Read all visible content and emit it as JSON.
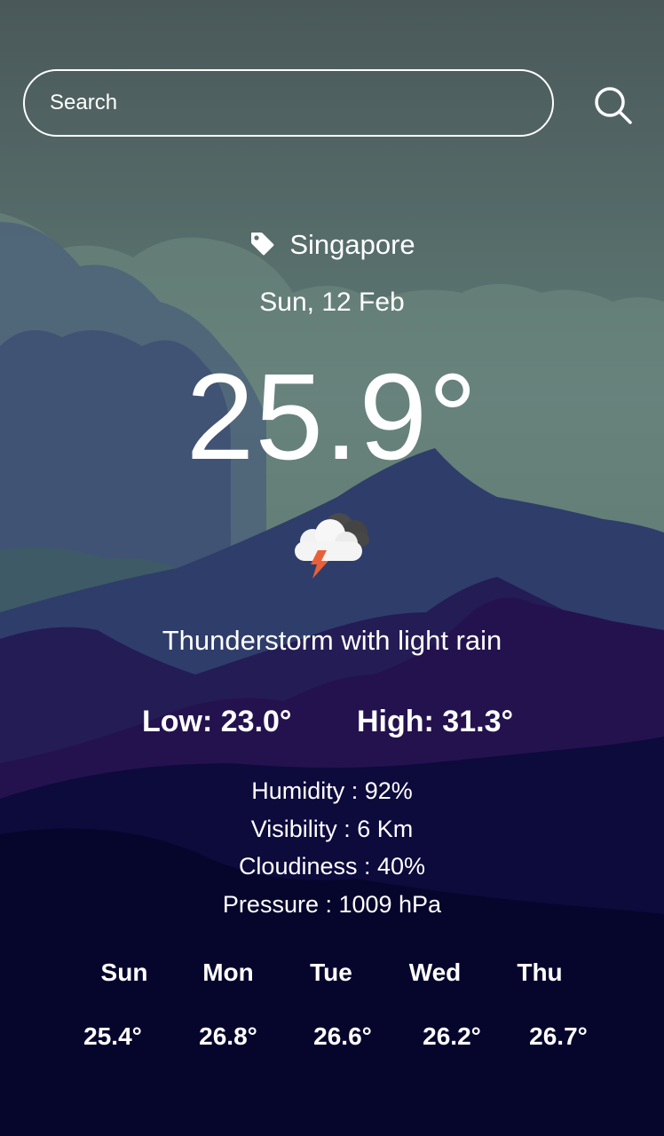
{
  "search": {
    "placeholder": "Search",
    "icon": "search-icon"
  },
  "location": {
    "icon": "tag-icon",
    "name": "Singapore"
  },
  "date": "Sun, 12 Feb",
  "current": {
    "temperature": "25.9°",
    "icon": "thunderstorm-icon",
    "description": "Thunderstorm with light rain",
    "low": "Low: 23.0°",
    "high": "High: 31.3°"
  },
  "details": [
    "Humidity : 92%",
    "Visibility : 6 Km",
    "Cloudiness : 40%",
    "Pressure : 1009 hPa"
  ],
  "forecast": [
    {
      "day": "Sun",
      "temp": "25.4°"
    },
    {
      "day": "Mon",
      "temp": "26.8°"
    },
    {
      "day": "Tue",
      "temp": "26.6°"
    },
    {
      "day": "Wed",
      "temp": "26.2°"
    },
    {
      "day": "Thu",
      "temp": "26.7°"
    }
  ],
  "colors": {
    "sky_top": "#4a5a5c",
    "sky_mid": "#63807a",
    "night_bottom": "#04042a",
    "bolt": "#e8603a"
  }
}
